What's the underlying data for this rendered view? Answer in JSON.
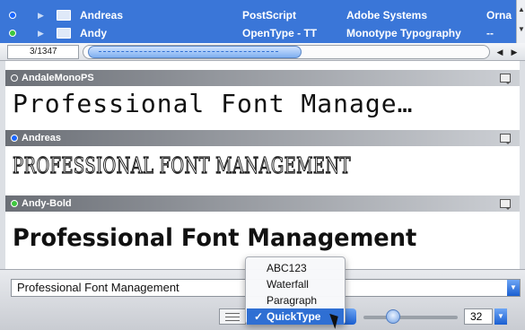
{
  "font_list": {
    "rows": [
      {
        "name": "Andreas",
        "type": "PostScript",
        "vendor": "Adobe Systems",
        "extra": "Orna",
        "dot_color": "#1a66ff"
      },
      {
        "name": "Andy",
        "type": "OpenType - TT",
        "vendor": "Monotype Typography",
        "extra": "--",
        "dot_color": "#3ec73e"
      }
    ]
  },
  "navigator": {
    "counter": "3/1347"
  },
  "previews": [
    {
      "font_name": "AndaleMonoPS",
      "dot_color": "#ffffff",
      "sample": "Professional Font Manage…"
    },
    {
      "font_name": "Andreas",
      "dot_color": "#1a66ff",
      "sample": "PROFESSIONAL FONT MANAGEMENT"
    },
    {
      "font_name": "Andy-Bold",
      "dot_color": "#3ec73e",
      "sample": "Professional Font Management"
    }
  ],
  "sample_text": {
    "value": "Professional Font Management"
  },
  "display_mode_menu": {
    "items": [
      "ABC123",
      "Waterfall",
      "Paragraph",
      "QuickType"
    ],
    "selected": "QuickType",
    "check": "✓"
  },
  "size": {
    "value": "32"
  },
  "colors": {
    "selection": "#3a76d8",
    "accent": "#2f6fd3"
  }
}
